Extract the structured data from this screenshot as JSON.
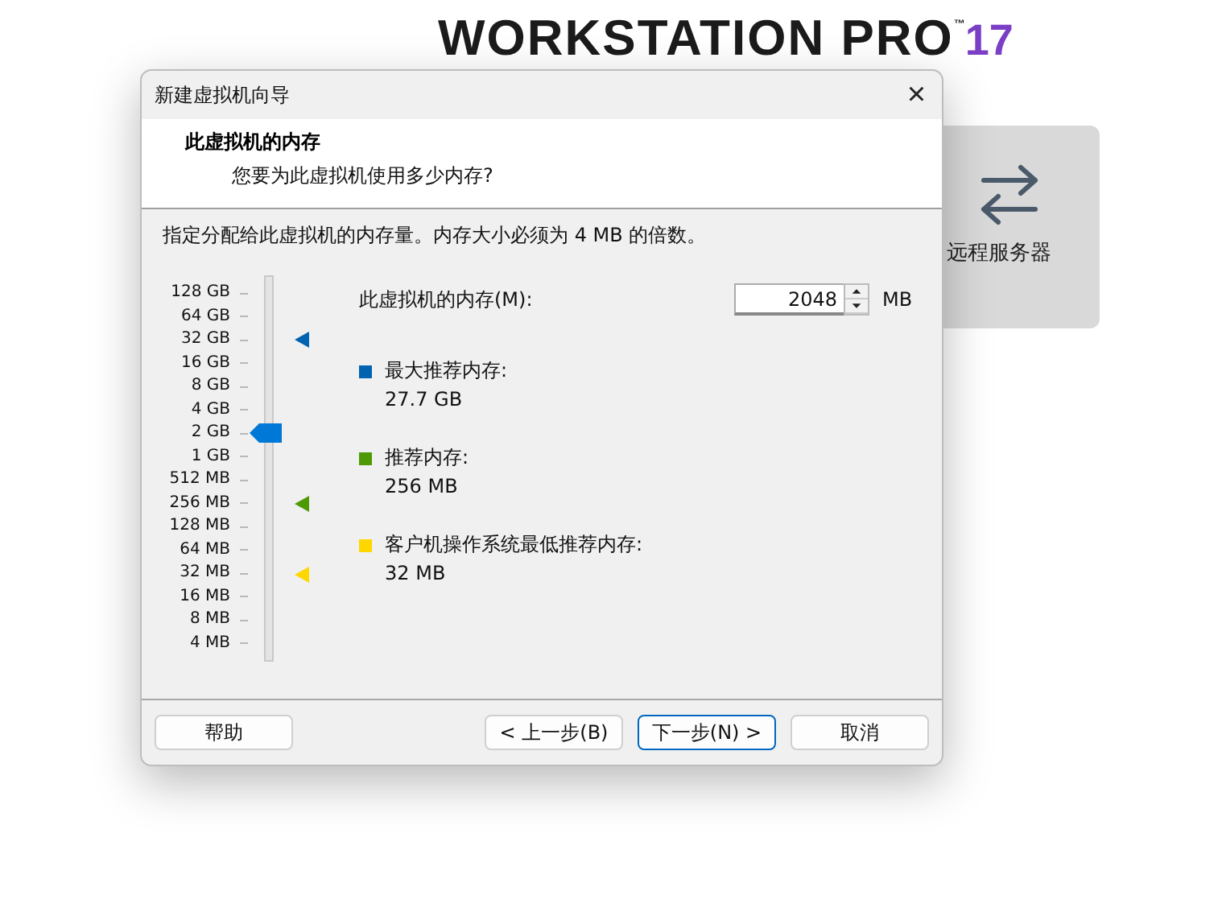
{
  "background": {
    "logo": {
      "name": "WORKSTATION PRO",
      "trademark": "™",
      "version": "17"
    },
    "card": {
      "label": "远程服务器"
    }
  },
  "dialog": {
    "title": "新建虚拟机向导",
    "close": "×",
    "header": {
      "title": "此虚拟机的内存",
      "subtitle": "您要为此虚拟机使用多少内存?"
    },
    "instruction": "指定分配给此虚拟机的内存量。内存大小必须为 4 MB 的倍数。",
    "scale": [
      "128 GB",
      "64 GB",
      "32 GB",
      "16 GB",
      "8 GB",
      "4 GB",
      "2 GB",
      "1 GB",
      "512 MB",
      "256 MB",
      "128 MB",
      "64 MB",
      "32 MB",
      "16 MB",
      "8 MB",
      "4 MB"
    ],
    "slider": {
      "level": 0.6
    },
    "memory": {
      "label": "此虚拟机的内存(M):",
      "value": "2048",
      "unit": "MB"
    },
    "legend": [
      {
        "label": "最大推荐内存:",
        "value": "27.7 GB",
        "color": "#0063b1",
        "level": 0.8667
      },
      {
        "label": "推荐内存:",
        "value": "256 MB",
        "color": "#4e9a06",
        "level": 0.4
      },
      {
        "label": "客户机操作系统最低推荐内存:",
        "value": "32 MB",
        "color": "#ffd700",
        "level": 0.2
      }
    ],
    "buttons": [
      {
        "label": "帮助",
        "kind": "help",
        "focused": false
      },
      {
        "label": "< 上一步(B)",
        "kind": "nav",
        "focused": false
      },
      {
        "label": "下一步(N) >",
        "kind": "nav",
        "focused": true
      },
      {
        "label": "取消",
        "kind": "nav",
        "focused": false
      }
    ]
  }
}
